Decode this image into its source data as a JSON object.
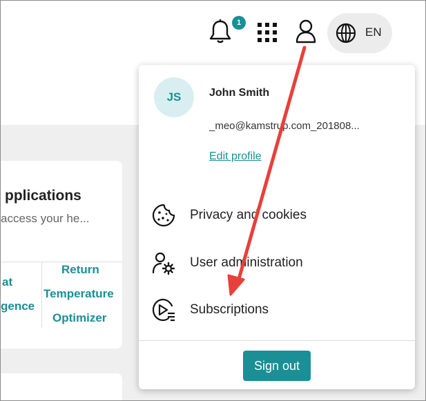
{
  "header": {
    "notifications_count": "1",
    "language": "EN"
  },
  "background_card": {
    "title": "pplications",
    "subtitle": "access your he...",
    "tile_left": [
      "at",
      "gence"
    ],
    "tile_right": [
      "Return",
      "Temperature",
      "Optimizer"
    ]
  },
  "profile_menu": {
    "initials": "JS",
    "name": "John Smith",
    "email": "_meo@kamstrup.com_201808...",
    "edit_profile_label": "Edit profile",
    "items": [
      {
        "label": "Privacy and cookies",
        "icon": "cookie-icon"
      },
      {
        "label": "User administration",
        "icon": "user-settings-icon"
      },
      {
        "label": "Subscriptions",
        "icon": "subscriptions-icon"
      }
    ],
    "sign_out_label": "Sign out"
  },
  "colors": {
    "accent": "#1a8f95",
    "arrow": "#e8403a"
  }
}
